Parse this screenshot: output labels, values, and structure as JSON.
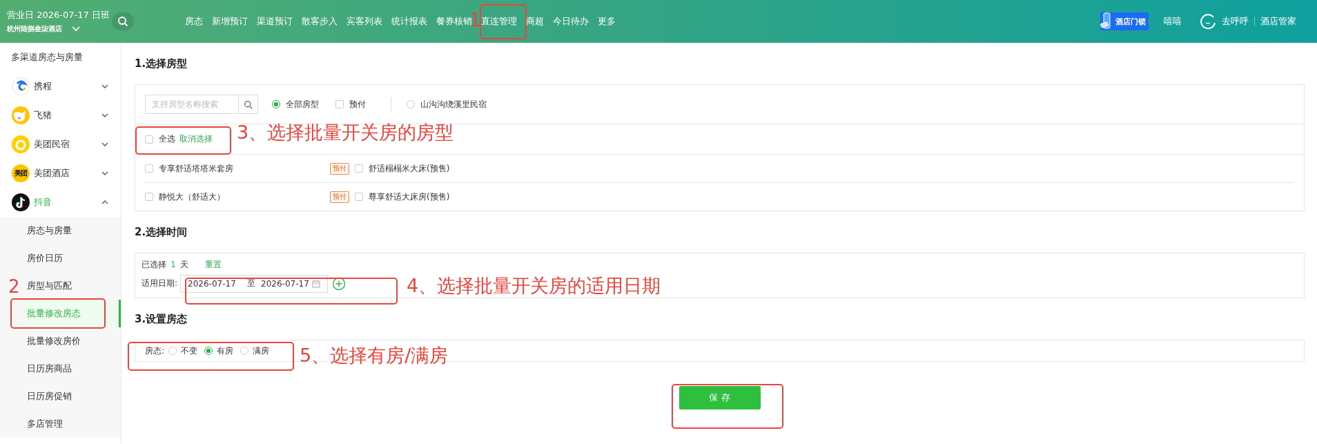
{
  "header": {
    "business_day": "营业日 2026-07-17 日班",
    "hotel": "杭州陆捌叁柒酒店",
    "nav": [
      "房态",
      "新增预订",
      "渠道预订",
      "散客步入",
      "宾客列表",
      "统计报表",
      "餐券核销",
      "直连管理",
      "商超",
      "今日待办",
      "更多"
    ],
    "door_lock": "酒店门锁",
    "user": "嘻嘻",
    "brand": "去呼呼",
    "brand_product": "酒店管家"
  },
  "sidebar": {
    "title": "多渠道房态与房量",
    "channels": [
      {
        "name": "携程",
        "kind": "swirl",
        "expanded": false
      },
      {
        "name": "飞猪",
        "kind": "pig",
        "expanded": false
      },
      {
        "name": "美团民宿",
        "kind": "ring",
        "expanded": false
      },
      {
        "name": "美团酒店",
        "kind": "text",
        "logo_text": "美团",
        "expanded": false
      },
      {
        "name": "抖音",
        "kind": "note",
        "expanded": true,
        "children": [
          {
            "label": "房态与房量",
            "selected": false
          },
          {
            "label": "房价日历",
            "selected": false
          },
          {
            "label": "房型与匹配",
            "selected": false
          },
          {
            "label": "批量修改房态",
            "selected": true
          },
          {
            "label": "批量修改房价",
            "selected": false
          },
          {
            "label": "日历房商品",
            "selected": false
          },
          {
            "label": "日历房促销",
            "selected": false
          },
          {
            "label": "多店管理",
            "selected": false
          }
        ]
      }
    ]
  },
  "room_types": {
    "title": "1.选择房型",
    "search": {
      "placeholder": "支持房型名称搜索"
    },
    "filters": [
      {
        "kind": "radio",
        "label": "全部房型",
        "selected": true
      },
      {
        "kind": "checkbox",
        "label": "预付",
        "checked": false
      },
      {
        "kind": "radio",
        "label": "山沟沟绕溪里民宿",
        "selected": false
      }
    ],
    "select_all": {
      "label": "全选",
      "checked": false
    },
    "clear": "取消选择",
    "rows": [
      [
        {
          "name": "专享舒适塔塔米套房",
          "checked": false,
          "tag": "预付"
        },
        {
          "name": "舒适榻榻米大床(预售)",
          "checked": false
        }
      ],
      [
        {
          "name": "静悦大（舒适大）",
          "checked": false,
          "tag": "预付"
        },
        {
          "name": "尊享舒适大床房(预售)",
          "checked": false
        }
      ]
    ]
  },
  "time": {
    "title": "2.选择时间",
    "selected_label": "已选择",
    "count": "1",
    "unit": "天",
    "reset": "重置",
    "date_label": "适用日期:",
    "start": "2026-07-17",
    "separator": "至",
    "end": "2026-07-17"
  },
  "status": {
    "title": "3.设置房态",
    "label": "房态:",
    "options": [
      {
        "label": "不变",
        "selected": false
      },
      {
        "label": "有房",
        "selected": true
      },
      {
        "label": "满房",
        "selected": false
      }
    ]
  },
  "save": "保 存",
  "annotations": [
    {
      "kind": "number",
      "text": "1"
    },
    {
      "kind": "number",
      "text": "2"
    },
    {
      "kind": "note",
      "text": "3、选择批量开关房的房型"
    },
    {
      "kind": "note",
      "text": "4、选择批量开关房的适用日期"
    },
    {
      "kind": "note",
      "text": "5、选择有房/满房"
    }
  ]
}
